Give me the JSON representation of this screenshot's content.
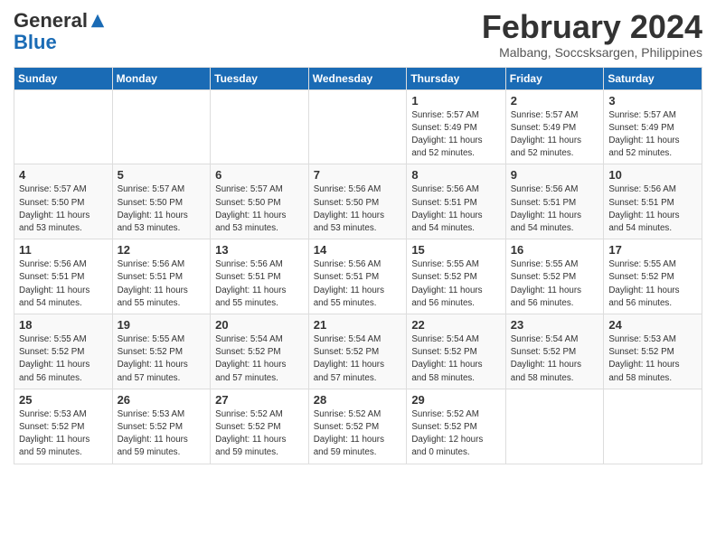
{
  "logo": {
    "general": "General",
    "blue": "Blue"
  },
  "title": {
    "month": "February 2024",
    "location": "Malbang, Soccsksargen, Philippines"
  },
  "days_of_week": [
    "Sunday",
    "Monday",
    "Tuesday",
    "Wednesday",
    "Thursday",
    "Friday",
    "Saturday"
  ],
  "weeks": [
    [
      {
        "day": "",
        "info": ""
      },
      {
        "day": "",
        "info": ""
      },
      {
        "day": "",
        "info": ""
      },
      {
        "day": "",
        "info": ""
      },
      {
        "day": "1",
        "info": "Sunrise: 5:57 AM\nSunset: 5:49 PM\nDaylight: 11 hours\nand 52 minutes."
      },
      {
        "day": "2",
        "info": "Sunrise: 5:57 AM\nSunset: 5:49 PM\nDaylight: 11 hours\nand 52 minutes."
      },
      {
        "day": "3",
        "info": "Sunrise: 5:57 AM\nSunset: 5:49 PM\nDaylight: 11 hours\nand 52 minutes."
      }
    ],
    [
      {
        "day": "4",
        "info": "Sunrise: 5:57 AM\nSunset: 5:50 PM\nDaylight: 11 hours\nand 53 minutes."
      },
      {
        "day": "5",
        "info": "Sunrise: 5:57 AM\nSunset: 5:50 PM\nDaylight: 11 hours\nand 53 minutes."
      },
      {
        "day": "6",
        "info": "Sunrise: 5:57 AM\nSunset: 5:50 PM\nDaylight: 11 hours\nand 53 minutes."
      },
      {
        "day": "7",
        "info": "Sunrise: 5:56 AM\nSunset: 5:50 PM\nDaylight: 11 hours\nand 53 minutes."
      },
      {
        "day": "8",
        "info": "Sunrise: 5:56 AM\nSunset: 5:51 PM\nDaylight: 11 hours\nand 54 minutes."
      },
      {
        "day": "9",
        "info": "Sunrise: 5:56 AM\nSunset: 5:51 PM\nDaylight: 11 hours\nand 54 minutes."
      },
      {
        "day": "10",
        "info": "Sunrise: 5:56 AM\nSunset: 5:51 PM\nDaylight: 11 hours\nand 54 minutes."
      }
    ],
    [
      {
        "day": "11",
        "info": "Sunrise: 5:56 AM\nSunset: 5:51 PM\nDaylight: 11 hours\nand 54 minutes."
      },
      {
        "day": "12",
        "info": "Sunrise: 5:56 AM\nSunset: 5:51 PM\nDaylight: 11 hours\nand 55 minutes."
      },
      {
        "day": "13",
        "info": "Sunrise: 5:56 AM\nSunset: 5:51 PM\nDaylight: 11 hours\nand 55 minutes."
      },
      {
        "day": "14",
        "info": "Sunrise: 5:56 AM\nSunset: 5:51 PM\nDaylight: 11 hours\nand 55 minutes."
      },
      {
        "day": "15",
        "info": "Sunrise: 5:55 AM\nSunset: 5:52 PM\nDaylight: 11 hours\nand 56 minutes."
      },
      {
        "day": "16",
        "info": "Sunrise: 5:55 AM\nSunset: 5:52 PM\nDaylight: 11 hours\nand 56 minutes."
      },
      {
        "day": "17",
        "info": "Sunrise: 5:55 AM\nSunset: 5:52 PM\nDaylight: 11 hours\nand 56 minutes."
      }
    ],
    [
      {
        "day": "18",
        "info": "Sunrise: 5:55 AM\nSunset: 5:52 PM\nDaylight: 11 hours\nand 56 minutes."
      },
      {
        "day": "19",
        "info": "Sunrise: 5:55 AM\nSunset: 5:52 PM\nDaylight: 11 hours\nand 57 minutes."
      },
      {
        "day": "20",
        "info": "Sunrise: 5:54 AM\nSunset: 5:52 PM\nDaylight: 11 hours\nand 57 minutes."
      },
      {
        "day": "21",
        "info": "Sunrise: 5:54 AM\nSunset: 5:52 PM\nDaylight: 11 hours\nand 57 minutes."
      },
      {
        "day": "22",
        "info": "Sunrise: 5:54 AM\nSunset: 5:52 PM\nDaylight: 11 hours\nand 58 minutes."
      },
      {
        "day": "23",
        "info": "Sunrise: 5:54 AM\nSunset: 5:52 PM\nDaylight: 11 hours\nand 58 minutes."
      },
      {
        "day": "24",
        "info": "Sunrise: 5:53 AM\nSunset: 5:52 PM\nDaylight: 11 hours\nand 58 minutes."
      }
    ],
    [
      {
        "day": "25",
        "info": "Sunrise: 5:53 AM\nSunset: 5:52 PM\nDaylight: 11 hours\nand 59 minutes."
      },
      {
        "day": "26",
        "info": "Sunrise: 5:53 AM\nSunset: 5:52 PM\nDaylight: 11 hours\nand 59 minutes."
      },
      {
        "day": "27",
        "info": "Sunrise: 5:52 AM\nSunset: 5:52 PM\nDaylight: 11 hours\nand 59 minutes."
      },
      {
        "day": "28",
        "info": "Sunrise: 5:52 AM\nSunset: 5:52 PM\nDaylight: 11 hours\nand 59 minutes."
      },
      {
        "day": "29",
        "info": "Sunrise: 5:52 AM\nSunset: 5:52 PM\nDaylight: 12 hours\nand 0 minutes."
      },
      {
        "day": "",
        "info": ""
      },
      {
        "day": "",
        "info": ""
      }
    ]
  ]
}
